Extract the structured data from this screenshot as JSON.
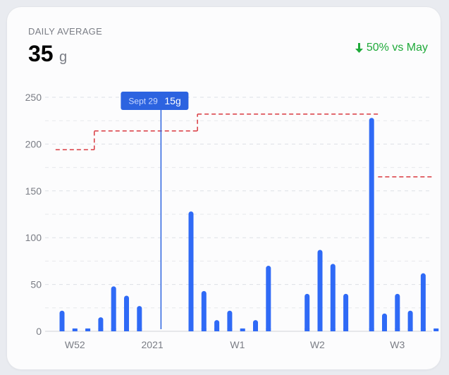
{
  "header": {
    "kicker": "DAILY AVERAGE",
    "value": "35",
    "unit": "g",
    "comparison_text": "50% vs May",
    "comparison_icon": "arrow-down-icon",
    "comparison_color": "#1faa3a"
  },
  "tooltip": {
    "date": "Sept 29",
    "value": "15g",
    "bar_index": 8
  },
  "chart_data": {
    "type": "bar",
    "title": "",
    "xlabel": "",
    "ylabel": "",
    "ylim": [
      0,
      250
    ],
    "yticks": [
      0,
      50,
      100,
      150,
      200,
      250
    ],
    "grid": true,
    "bar_color": "#2f6af6",
    "tooltip_color": "#2c63e0",
    "average_color": "#d9383f",
    "x_labels": [
      {
        "label": "W52",
        "index": 1
      },
      {
        "label": "2021",
        "index": 7
      },
      {
        "label": "W1",
        "index": 13.6
      },
      {
        "label": "W2",
        "index": 19.8
      },
      {
        "label": "W3",
        "index": 26
      }
    ],
    "values": [
      22,
      3,
      3,
      15,
      48,
      38,
      27,
      0,
      0,
      0,
      128,
      43,
      12,
      22,
      3,
      12,
      70,
      0,
      0,
      40,
      87,
      72,
      40,
      0,
      228,
      19,
      40,
      22,
      62,
      3
    ],
    "average_steps": [
      {
        "from": -0.5,
        "to": 2.5,
        "value": 194
      },
      {
        "from": 2.5,
        "to": 10.5,
        "value": 214
      },
      {
        "from": 10.5,
        "to": 24.5,
        "value": 232
      },
      {
        "from": 24.5,
        "to": 29.5,
        "value": 165
      }
    ]
  }
}
